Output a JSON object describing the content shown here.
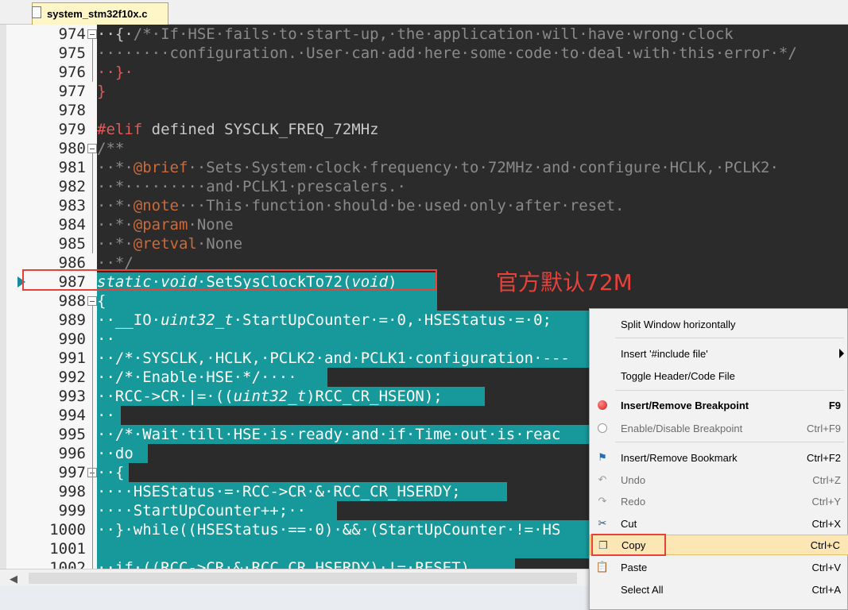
{
  "tab": {
    "title": "system_stm32f10x.c"
  },
  "lines": [
    {
      "num": "974",
      "fold": true
    },
    {
      "num": "975"
    },
    {
      "num": "976"
    },
    {
      "num": "977"
    },
    {
      "num": "978"
    },
    {
      "num": "979"
    },
    {
      "num": "980",
      "fold": true
    },
    {
      "num": "981"
    },
    {
      "num": "982"
    },
    {
      "num": "983"
    },
    {
      "num": "984"
    },
    {
      "num": "985"
    },
    {
      "num": "986"
    },
    {
      "num": "987"
    },
    {
      "num": "988",
      "fold": true
    },
    {
      "num": "989"
    },
    {
      "num": "990"
    },
    {
      "num": "991"
    },
    {
      "num": "992"
    },
    {
      "num": "993"
    },
    {
      "num": "994"
    },
    {
      "num": "995"
    },
    {
      "num": "996"
    },
    {
      "num": "997",
      "fold": true
    },
    {
      "num": "998"
    },
    {
      "num": "999"
    },
    {
      "num": "1000"
    },
    {
      "num": "1001"
    },
    {
      "num": "1002"
    }
  ],
  "code": {
    "l974": {
      "indent": "··{·",
      "comment": "/*·If·HSE·fails·to·start-up,·the·application·will·have·wrong·clock"
    },
    "l975": {
      "text": "········configuration.·User·can·add·here·some·code·to·deal·with·this·error·*/"
    },
    "l976": {
      "text": "··}·"
    },
    "l977": {
      "text": "}"
    },
    "l979": {
      "pp": "#elif",
      "text": " defined SYSCLK_FREQ_72MHz"
    },
    "l980": {
      "text": "/**"
    },
    "l981": {
      "pre": "··*·",
      "tag": "@brief",
      "text": "··Sets·System·clock·frequency·to·72MHz·and·configure·HCLK,·PCLK2·"
    },
    "l982": {
      "text": "··*·········and·PCLK1·prescalers.·"
    },
    "l983": {
      "pre": "··*·",
      "tag": "@note",
      "text": "···This·function·should·be·used·only·after·reset."
    },
    "l984": {
      "pre": "··*·",
      "tag": "@param",
      "text": "·None"
    },
    "l985": {
      "pre": "··*·",
      "tag": "@retval",
      "text": "·None"
    },
    "l986": {
      "text": "··*/"
    },
    "l987": {
      "kw1": "static",
      "kw2": "void",
      "fn": "SetSysClockTo72(",
      "kw3": "void",
      "end": ")"
    },
    "l988": {
      "text": "{"
    },
    "l989": {
      "pre": "··__IO·",
      "type": "uint32_t",
      "text": "·StartUpCounter·=·0,·HSEStatus·=·0;"
    },
    "l990": {
      "text": "··"
    },
    "l991": {
      "text": "··/*·SYSCLK,·HCLK,·PCLK2·and·PCLK1·configuration·---"
    },
    "l992": {
      "text": "··/*·Enable·HSE·*/····"
    },
    "l993": {
      "pre": "··RCC->CR·|=·((",
      "type": "uint32_t",
      "text": ")RCC_CR_HSEON);"
    },
    "l994": {
      "text": "··"
    },
    "l995": {
      "text": "··/*·Wait·till·HSE·is·ready·and·if·Time·out·is·reac"
    },
    "l996": {
      "text": "··do"
    },
    "l997": {
      "text": "··{"
    },
    "l998": {
      "text": "····HSEStatus·=·RCC->CR·&·RCC_CR_HSERDY;"
    },
    "l999": {
      "text": "····StartUpCounter++;··"
    },
    "l1000": {
      "text": "··}·while((HSEStatus·==·0)·&&·(StartUpCounter·!=·HS"
    },
    "l1001": {
      "text": ""
    },
    "l1002": {
      "text": "··if·((RCC->CR·&·RCC_CR_HSERDY)·!=·RESET)"
    }
  },
  "annotation": {
    "text": "官方默认72M"
  },
  "menu": {
    "split": {
      "label": "Split Window horizontally"
    },
    "insert_include": {
      "label": "Insert '#include file'"
    },
    "toggle_header": {
      "label": "Toggle Header/Code File"
    },
    "breakpoint": {
      "label": "Insert/Remove Breakpoint",
      "shortcut": "F9"
    },
    "enable_breakpoint": {
      "label": "Enable/Disable Breakpoint",
      "shortcut": "Ctrl+F9"
    },
    "bookmark": {
      "label": "Insert/Remove Bookmark",
      "shortcut": "Ctrl+F2"
    },
    "undo": {
      "label": "Undo",
      "shortcut": "Ctrl+Z"
    },
    "redo": {
      "label": "Redo",
      "shortcut": "Ctrl+Y"
    },
    "cut": {
      "label": "Cut",
      "shortcut": "Ctrl+X"
    },
    "copy": {
      "label": "Copy",
      "shortcut": "Ctrl+C"
    },
    "paste": {
      "label": "Paste",
      "shortcut": "Ctrl+V"
    },
    "select_all": {
      "label": "Select All",
      "shortcut": "Ctrl+A"
    }
  }
}
